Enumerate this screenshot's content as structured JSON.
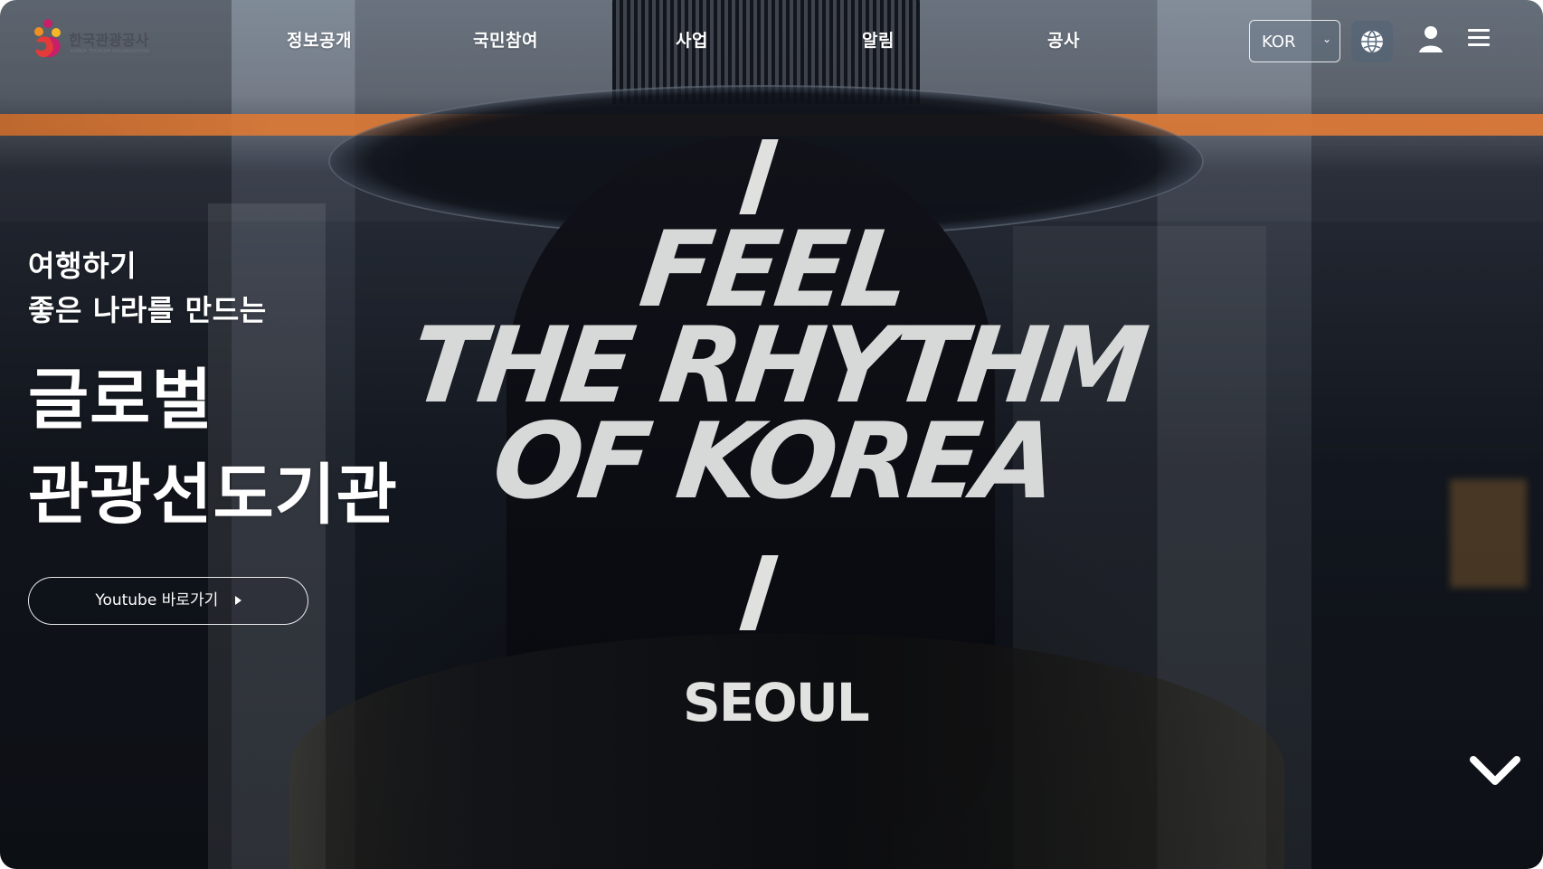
{
  "logo": {
    "name": "한국관광공사",
    "subtitle": "KOREA TOURISM ORGANIZATION",
    "icon": "korea-tourism-logo"
  },
  "nav": {
    "items": [
      {
        "label": "정보공개"
      },
      {
        "label": "국민참여"
      },
      {
        "label": "사업"
      },
      {
        "label": "알림"
      },
      {
        "label": "공사"
      }
    ],
    "language": {
      "selected": "KOR",
      "options": [
        "KOR"
      ]
    },
    "icons": {
      "globe": "globe-icon",
      "user": "user-icon",
      "menu": "hamburger-menu-icon"
    }
  },
  "hero": {
    "line1": "여행하기",
    "line2": "좋은 나라를 만드는",
    "title_line1": "글로벌",
    "title_line2": "관광선도기관",
    "button_label": "Youtube 바로가기",
    "campaign": {
      "line1": "FEEL",
      "line2": "THE RHYTHM",
      "line3": "OF KOREA",
      "city": "SEOUL"
    }
  },
  "scroll": {
    "icon": "chevron-down-icon"
  },
  "colors": {
    "accent_orange": "#dd7a37",
    "logo_red": "#e33a3a",
    "logo_orange": "#ef8e22",
    "logo_pink": "#c71f6a",
    "text": "#ffffff"
  }
}
